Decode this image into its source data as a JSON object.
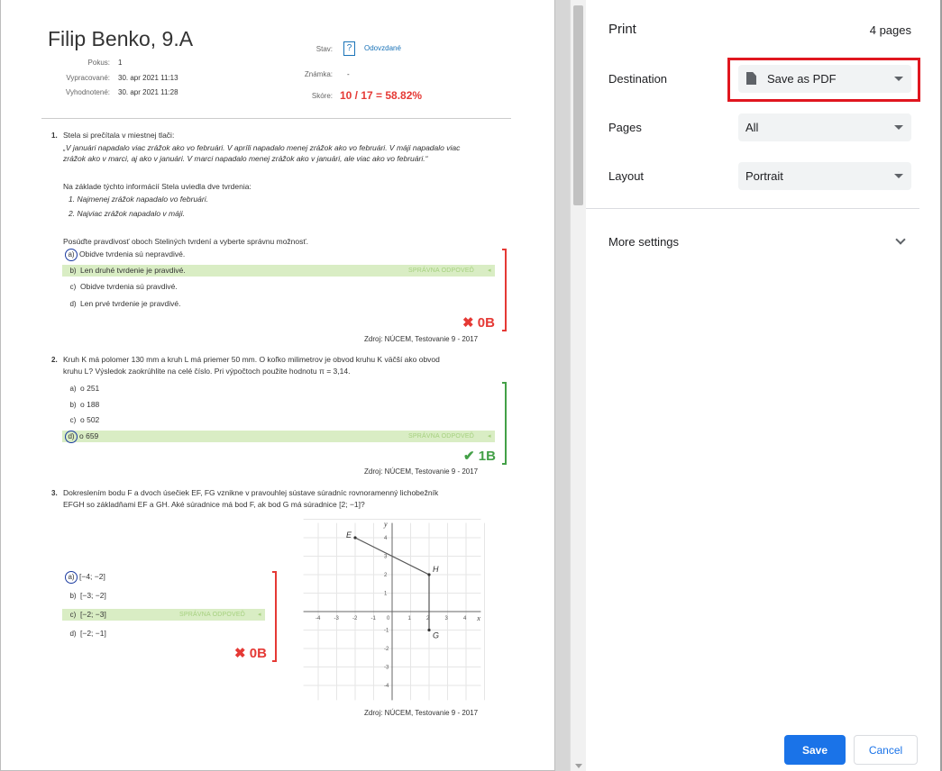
{
  "test": {
    "student": "Filip Benko, 9.A",
    "meta": {
      "attempt_label": "Pokus:",
      "attempt_value": "1",
      "worked_label": "Vypracované:",
      "worked_value": "30. apr 2021 11:13",
      "evaluated_label": "Vyhodnotené:",
      "evaluated_value": "30. apr 2021 11:28",
      "status_label": "Stav:",
      "status_icon": "?",
      "status_value": "Odovzdané",
      "grade_label": "Známka:",
      "grade_value": "-",
      "score_label": "Skóre:",
      "score_value": "10 / 17 = 58.82%"
    },
    "correct_label": "SPRÁVNA ODPOVEĎ",
    "q1": {
      "num": "1.",
      "intro": "Stela si prečítala v miestnej tlači:",
      "quote_1": "„V januári napadalo viac zrážok ako vo februári. V apríli napadalo menej zrážok ako vo februári. V máji napadalo viac",
      "quote_2": "zrážok ako v marci, aj ako v januári. V marci napadalo menej zrážok ako v januári, ale viac ako vo februári.“",
      "statement_intro": "Na základe týchto informácií Stela uviedla dve tvrdenia:",
      "statement_1": "1. Najmenej zrážok napadalo vo februári.",
      "statement_2": "2. Najviac zrážok napadalo v máji.",
      "task": "Posúďte pravdivosť oboch Steliných tvrdení a vyberte správnu možnosť.",
      "options": [
        {
          "letter": "a)",
          "text": "Obidve tvrdenia sú nepravdivé."
        },
        {
          "letter": "b)",
          "text": "Len druhé tvrdenie je pravdivé."
        },
        {
          "letter": "c)",
          "text": "Obidve tvrdenia sú pravdivé."
        },
        {
          "letter": "d)",
          "text": "Len prvé tvrdenie je pravdivé."
        }
      ],
      "result": "✖ 0B",
      "source": "Zdroj: NÚCEM, Testovanie 9 - 2017"
    },
    "q2": {
      "num": "2.",
      "text_1": "Kruh K má polomer 130 mm a kruh L má priemer 50 mm. O koľko milimetrov je obvod kruhu K väčší ako obvod",
      "text_2": "kruhu L? Výsledok zaokrúhlite na celé číslo. Pri výpočtoch použite hodnotu π = 3,14.",
      "options": [
        {
          "letter": "a)",
          "text": "o 251"
        },
        {
          "letter": "b)",
          "text": "o 188"
        },
        {
          "letter": "c)",
          "text": "o 502"
        },
        {
          "letter": "d)",
          "text": "o 659"
        }
      ],
      "result": "✔ 1B",
      "source": "Zdroj: NÚCEM, Testovanie 9 - 2017"
    },
    "q3": {
      "num": "3.",
      "text_1": "Dokreslením bodu F a dvoch úsečiek EF, FG vznikne v pravouhlej sústave súradníc rovnoramenný lichobežník",
      "text_2": "EFGH so základňami EF a GH. Aké súradnice má bod F, ak bod G má súradnice [2; −1]?",
      "options": [
        {
          "letter": "a)",
          "text": "[−4; −2]"
        },
        {
          "letter": "b)",
          "text": "[−3; −2]"
        },
        {
          "letter": "c)",
          "text": "[−2; −3]"
        },
        {
          "letter": "d)",
          "text": "[−2; −1]"
        }
      ],
      "result": "✖ 0B",
      "source": "Zdroj: NÚCEM, Testovanie 9 - 2017",
      "graph": {
        "x_label": "x",
        "y_label": "y",
        "x_ticks": [
          "-4",
          "-3",
          "-2",
          "-1",
          "0",
          "1",
          "2",
          "3",
          "4"
        ],
        "y_ticks": [
          "4",
          "3",
          "2",
          "1",
          "-1",
          "-2",
          "-3",
          "-4"
        ],
        "points": [
          {
            "name": "E",
            "x": -2,
            "y": 4
          },
          {
            "name": "H",
            "x": 2,
            "y": 2
          },
          {
            "name": "G",
            "x": 2,
            "y": -1
          }
        ]
      }
    }
  },
  "print": {
    "title": "Print",
    "page_count": "4 pages",
    "destination_label": "Destination",
    "destination_value": "Save as PDF",
    "pages_label": "Pages",
    "pages_value": "All",
    "layout_label": "Layout",
    "layout_value": "Portrait",
    "more_settings": "More settings",
    "save": "Save",
    "cancel": "Cancel"
  },
  "colors": {
    "wrong": "#e53935",
    "right": "#43a047",
    "correct_fill": "#d9edc4",
    "accent": "#1a73e8",
    "highlight_box": "#e0161f"
  }
}
